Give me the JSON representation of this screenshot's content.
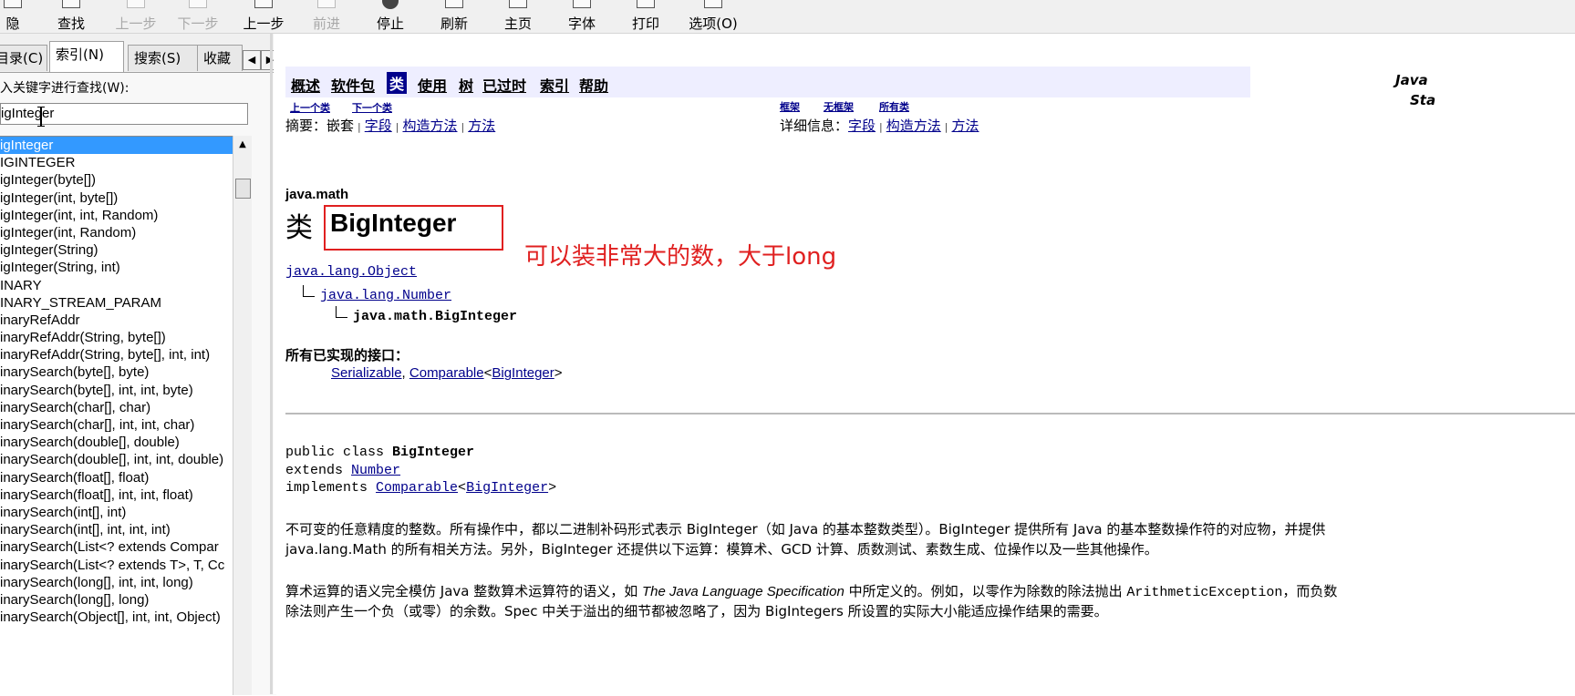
{
  "toolbar": {
    "buttons": [
      {
        "label": "隐藏",
        "icon": "hide-pane-icon",
        "disabled": false
      },
      {
        "label": "查找",
        "icon": "find-icon",
        "disabled": false
      },
      {
        "label": "上一步",
        "icon": "arrow-up-icon",
        "disabled": true
      },
      {
        "label": "下一步",
        "icon": "arrow-down-icon",
        "disabled": true
      },
      {
        "label": "上一步",
        "icon": "back-icon",
        "disabled": false
      },
      {
        "label": "前进",
        "icon": "forward-icon",
        "disabled": true
      },
      {
        "label": "停止",
        "icon": "stop-icon",
        "disabled": false
      },
      {
        "label": "刷新",
        "icon": "refresh-icon",
        "disabled": false
      },
      {
        "label": "主页",
        "icon": "home-icon",
        "disabled": false
      },
      {
        "label": "字体",
        "icon": "font-icon",
        "disabled": false
      },
      {
        "label": "打印",
        "icon": "print-icon",
        "disabled": false
      },
      {
        "label": "选项(O)",
        "icon": "options-icon",
        "disabled": false
      }
    ]
  },
  "nav": {
    "tabs": [
      {
        "label": "目录(C)",
        "active": false
      },
      {
        "label": "索引(N)",
        "active": true
      },
      {
        "label": "搜索(S)",
        "active": false
      },
      {
        "label": "收藏",
        "active": false
      }
    ],
    "keyword_label": "入关键字进行查找(W):",
    "keyword_value": "igInteger",
    "index_items": [
      "igInteger",
      "IGINTEGER",
      "igInteger(byte[])",
      "igInteger(int, byte[])",
      "igInteger(int, int, Random)",
      "igInteger(int, Random)",
      "igInteger(String)",
      "igInteger(String, int)",
      "INARY",
      "INARY_STREAM_PARAM",
      "inaryRefAddr",
      "inaryRefAddr(String, byte[])",
      "inaryRefAddr(String, byte[], int, int)",
      "inarySearch(byte[], byte)",
      "inarySearch(byte[], int, int, byte)",
      "inarySearch(char[], char)",
      "inarySearch(char[], int, int, char)",
      "inarySearch(double[], double)",
      "inarySearch(double[], int, int, double)",
      "inarySearch(float[], float)",
      "inarySearch(float[], int, int, float)",
      "inarySearch(int[], int)",
      "inarySearch(int[], int, int, int)",
      "inarySearch(List<? extends Compar",
      "inarySearch(List<? extends T>, T, Cc",
      "inarySearch(long[], int, int, long)",
      "inarySearch(long[], long)",
      "inarySearch(Object[], int, int, Object)"
    ],
    "selected_index": 0
  },
  "doc": {
    "navbar": [
      "概述",
      "软件包",
      "类",
      "使用",
      "树",
      "已过时",
      "索引",
      "帮助"
    ],
    "navbar_current": 2,
    "java_std_line1": "Java",
    "java_std_line2": "Sta",
    "prev_class": "上一个类",
    "next_class": "下一个类",
    "frames": "框架",
    "no_frames": "无框架",
    "all_classes": "所有类",
    "summary_label": "摘要：",
    "summary_nested": "嵌套",
    "detail_label": "详细信息：",
    "field": "字段",
    "constructor": "构造方法",
    "method": "方法",
    "package": "java.math",
    "class_word": "类",
    "class_name": "BigInteger",
    "annotation": "可以装非常大的数，大于long",
    "hierarchy": [
      "java.lang.Object",
      "java.lang.Number",
      "java.math.BigInteger"
    ],
    "interfaces_heading": "所有已实现的接口：",
    "iface_serializable": "Serializable",
    "iface_comparable": "Comparable",
    "iface_param": "BigInteger",
    "decl_public": "public class ",
    "decl_name": "BigInteger",
    "decl_extends": "extends ",
    "decl_number": "Number",
    "decl_implements": "implements ",
    "decl_comparable": "Comparable",
    "decl_param": "BigInteger",
    "para1_line1": "不可变的任意精度的整数。所有操作中，都以二进制补码形式表示 BigInteger（如 Java 的基本整数类型）。BigInteger 提供所有 Java 的基本整数操作符的对应物，并提供",
    "para1_line2": "java.lang.Math 的所有相关方法。另外，BigInteger 还提供以下运算：模算术、GCD 计算、质数测试、素数生成、位操作以及一些其他操作。",
    "para2_a": "算术运算的语义完全模仿 Java 整数算术运算符的语义，如 ",
    "para2_spec": "The Java Language Specification",
    "para2_b": " 中所定义的。例如，以零作为除数的除法抛出 ",
    "para2_exc": "ArithmeticException",
    "para2_c": "，而负数",
    "para2_line2": "除法则产生一个负（或零）的余数。Spec 中关于溢出的细节都被忽略了，因为 BigIntegers 所设置的实际大小能适应操作结果的需要。"
  }
}
